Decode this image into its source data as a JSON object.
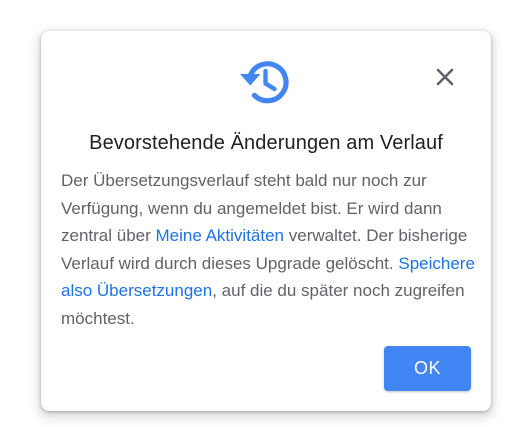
{
  "dialog": {
    "title": "Bevorstehende Änderungen am Verlauf",
    "body": {
      "part1": "Der Übersetzungsverlauf steht bald nur noch zur Verfügung, wenn du angemeldet bist. Er wird dann zentral über ",
      "link1": "Meine Aktivitäten",
      "part2": " verwaltet. Der bisherige Verlauf wird durch dieses Upgrade gelöscht. ",
      "link2": "Speichere also Übersetzungen",
      "part3": ", auf die du später noch zugreifen möchtest."
    },
    "ok_label": "OK",
    "icons": {
      "header": "history-icon",
      "close": "close-icon"
    },
    "colors": {
      "accent": "#4285f4",
      "link": "#1a73e8",
      "title": "#202124",
      "text": "#5f6368"
    }
  }
}
